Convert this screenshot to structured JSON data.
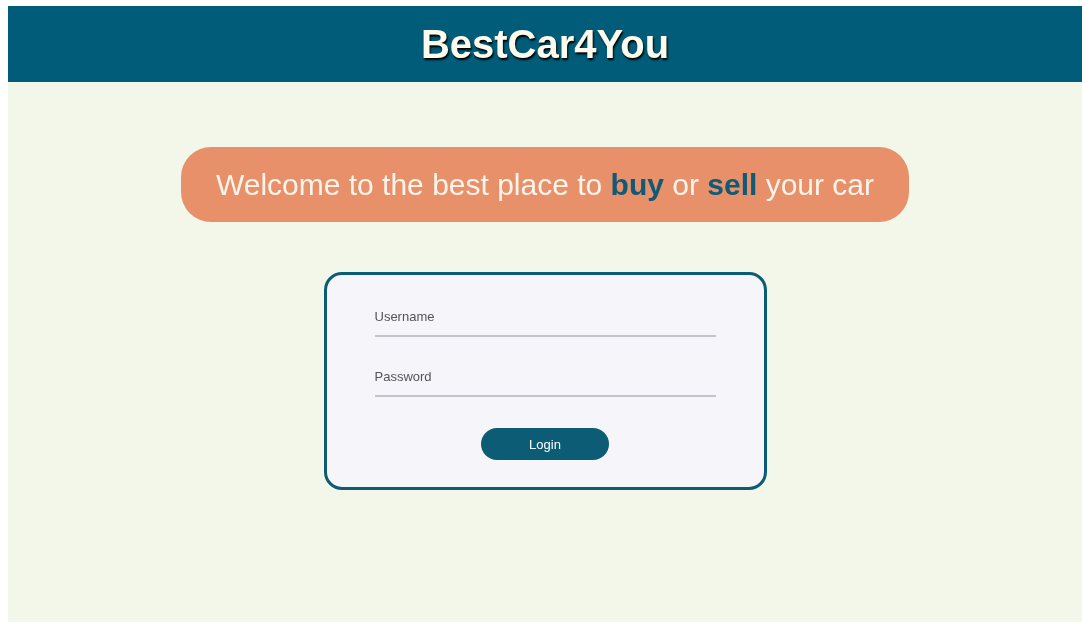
{
  "header": {
    "title": "BestCar4You"
  },
  "banner": {
    "text": "Welcome to the best place to **buy** or **sell** your car"
  },
  "login_form": {
    "fields": [
      {
        "placeholder": "Username"
      },
      {
        "placeholder": "Password"
      }
    ],
    "button": "Login"
  }
}
